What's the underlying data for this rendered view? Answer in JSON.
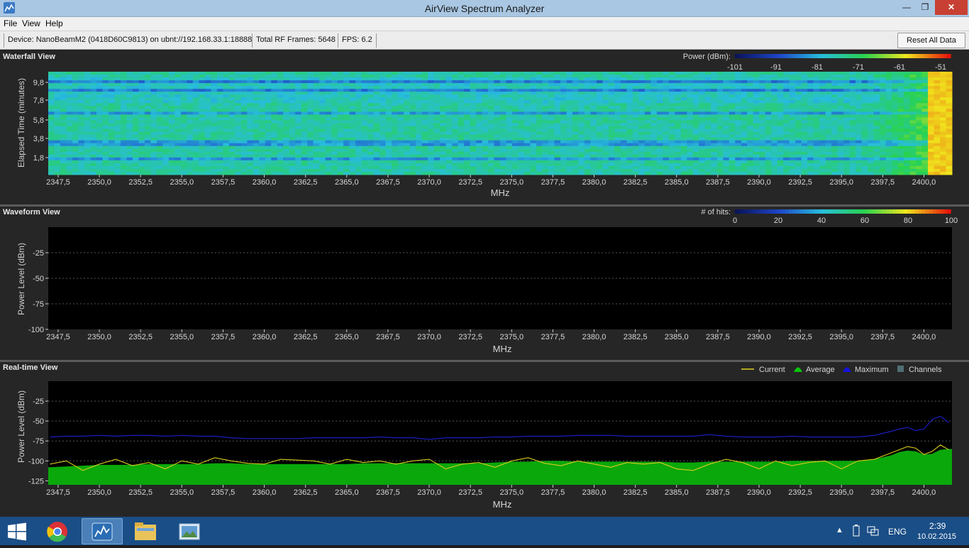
{
  "window": {
    "title": "AirView Spectrum Analyzer",
    "minimize": "—",
    "maximize": "❐",
    "close": "✕"
  },
  "menu": [
    {
      "label": "File"
    },
    {
      "label": "View"
    },
    {
      "label": "Help"
    }
  ],
  "status": {
    "device": "Device: NanoBeamM2 (0418D60C9813) on ubnt://192.168.33.1:18888",
    "frames": "Total RF Frames: 5648",
    "fps": "FPS: 6.2",
    "reset_label": "Reset All Data"
  },
  "freq_ticks": [
    "2347,5",
    "2350,0",
    "2352,5",
    "2355,0",
    "2357,5",
    "2360,0",
    "2362,5",
    "2365,0",
    "2367,5",
    "2370,0",
    "2372,5",
    "2375,0",
    "2377,5",
    "2380,0",
    "2382,5",
    "2385,0",
    "2387,5",
    "2390,0",
    "2392,5",
    "2395,0",
    "2397,5",
    "2400,0"
  ],
  "waterfall": {
    "title": "Waterfall View",
    "ylabel": "Elapsed Time (minutes)",
    "xlabel": "MHz",
    "yticks": [
      "9,8",
      "7,8",
      "5,8",
      "3,8",
      "1,8"
    ],
    "legend_label": "Power (dBm):",
    "legend_ticks": [
      "-101",
      "-91",
      "-81",
      "-71",
      "-61",
      "-51"
    ]
  },
  "waveform": {
    "title": "Waveform View",
    "ylabel": "Power Level (dBm)",
    "xlabel": "MHz",
    "yticks": [
      "-25",
      "-50",
      "-75",
      "-100"
    ],
    "legend_label": "# of hits:",
    "legend_ticks": [
      "0",
      "20",
      "40",
      "60",
      "80",
      "100"
    ]
  },
  "realtime": {
    "title": "Real-time View",
    "ylabel": "Power Level (dBm)",
    "xlabel": "MHz",
    "yticks": [
      "-25",
      "-50",
      "-75",
      "-100",
      "-125"
    ],
    "legend": [
      {
        "label": "Current",
        "color": "#e0d21e"
      },
      {
        "label": "Average",
        "color": "#0bc40b"
      },
      {
        "label": "Maximum",
        "color": "#1414d8"
      },
      {
        "label": "Channels",
        "color": "#4f6f73"
      }
    ]
  },
  "chart_data": [
    {
      "type": "heatmap",
      "title": "Waterfall View",
      "xlabel": "MHz",
      "ylabel": "Elapsed Time (minutes)",
      "xlim": [
        2346.9,
        2401.7
      ],
      "ylim": [
        0,
        10.8
      ],
      "value_unit": "dBm",
      "value_range": [
        -101,
        -46
      ],
      "note_strong_band_mhz": [
        2400.1,
        2401.7
      ]
    },
    {
      "type": "heatmap",
      "title": "Waveform View",
      "xlabel": "MHz",
      "ylabel": "Power Level (dBm)",
      "xlim": [
        2346.9,
        2401.7
      ],
      "ylim": [
        -100,
        0
      ],
      "value_unit": "# of hits",
      "value_range": [
        0,
        100
      ]
    },
    {
      "type": "line",
      "title": "Real-time View",
      "xlabel": "MHz",
      "ylabel": "Power Level (dBm)",
      "xlim": [
        2346.9,
        2401.7
      ],
      "ylim": [
        -130,
        0
      ],
      "x": [
        2347.0,
        2348.0,
        2349.0,
        2350.0,
        2351.0,
        2352.0,
        2353.0,
        2354.0,
        2355.0,
        2356.0,
        2357.0,
        2358.0,
        2359.0,
        2360.0,
        2361.0,
        2362.0,
        2363.0,
        2364.0,
        2365.0,
        2366.0,
        2367.0,
        2368.0,
        2369.0,
        2370.0,
        2371.0,
        2372.0,
        2373.0,
        2374.0,
        2375.0,
        2376.0,
        2377.0,
        2378.0,
        2379.0,
        2380.0,
        2381.0,
        2382.0,
        2383.0,
        2384.0,
        2385.0,
        2386.0,
        2387.0,
        2388.0,
        2389.0,
        2390.0,
        2391.0,
        2392.0,
        2393.0,
        2394.0,
        2395.0,
        2396.0,
        2397.0,
        2398.0,
        2398.5,
        2399.0,
        2399.5,
        2400.0,
        2400.5,
        2401.0,
        2401.5
      ],
      "series": [
        {
          "name": "Current",
          "values": [
            -104,
            -100,
            -112,
            -104,
            -98,
            -106,
            -102,
            -110,
            -100,
            -104,
            -96,
            -100,
            -103,
            -104,
            -98,
            -99,
            -100,
            -104,
            -98,
            -102,
            -100,
            -104,
            -100,
            -98,
            -110,
            -104,
            -102,
            -108,
            -100,
            -96,
            -103,
            -106,
            -100,
            -104,
            -108,
            -102,
            -104,
            -102,
            -110,
            -112,
            -104,
            -98,
            -102,
            -110,
            -100,
            -106,
            -102,
            -100,
            -110,
            -100,
            -98,
            -90,
            -86,
            -82,
            -84,
            -92,
            -88,
            -80,
            -86
          ]
        },
        {
          "name": "Average",
          "values": [
            -108,
            -107,
            -106,
            -105,
            -105,
            -105,
            -104,
            -104,
            -104,
            -104,
            -103,
            -103,
            -104,
            -104,
            -104,
            -104,
            -104,
            -104,
            -104,
            -103,
            -103,
            -103,
            -103,
            -103,
            -103,
            -103,
            -103,
            -102,
            -101,
            -101,
            -100,
            -100,
            -101,
            -101,
            -101,
            -101,
            -101,
            -101,
            -102,
            -102,
            -101,
            -101,
            -101,
            -101,
            -101,
            -100,
            -100,
            -100,
            -100,
            -100,
            -98,
            -93,
            -89,
            -87,
            -88,
            -92,
            -91,
            -86,
            -85
          ]
        },
        {
          "name": "Maximum",
          "values": [
            -70,
            -69,
            -69,
            -68,
            -69,
            -68,
            -68,
            -69,
            -68,
            -69,
            -69,
            -71,
            -72,
            -72,
            -72,
            -72,
            -71,
            -71,
            -71,
            -71,
            -70,
            -71,
            -71,
            -73,
            -71,
            -71,
            -71,
            -70,
            -70,
            -69,
            -69,
            -69,
            -68,
            -68,
            -68,
            -69,
            -69,
            -69,
            -69,
            -69,
            -67,
            -69,
            -70,
            -70,
            -70,
            -69,
            -70,
            -70,
            -70,
            -70,
            -68,
            -63,
            -60,
            -58,
            -62,
            -60,
            -48,
            -44,
            -52
          ]
        }
      ]
    }
  ]
}
